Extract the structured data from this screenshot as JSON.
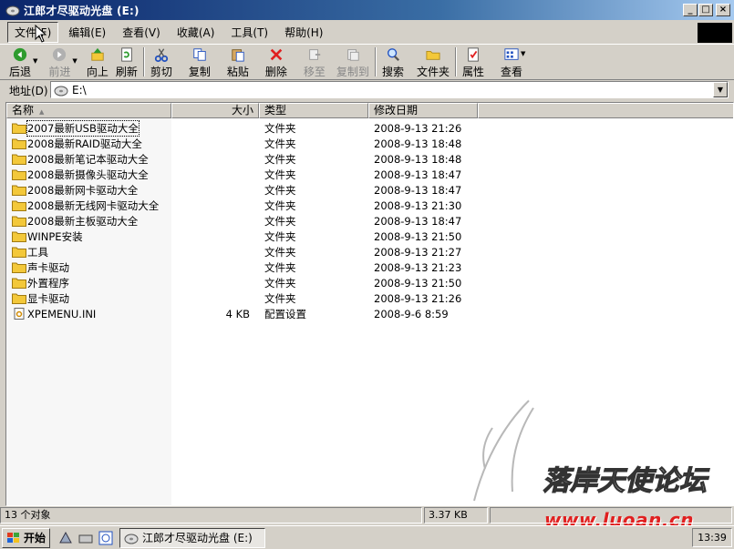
{
  "window": {
    "title": "江郎才尽驱动光盘 (E:)"
  },
  "menu": [
    "文件(F)",
    "编辑(E)",
    "查看(V)",
    "收藏(A)",
    "工具(T)",
    "帮助(H)"
  ],
  "toolbar": {
    "back": "后退",
    "forward": "前进",
    "up": "向上",
    "refresh": "刷新",
    "cut": "剪切",
    "copy": "复制",
    "paste": "粘贴",
    "delete": "删除",
    "move_to": "移至",
    "copy_to": "复制到",
    "search": "搜索",
    "folders": "文件夹",
    "properties": "属性",
    "view": "查看"
  },
  "address": {
    "label": "地址(D)",
    "value": "E:\\"
  },
  "columns": {
    "name": "名称",
    "size": "大小",
    "type": "类型",
    "modified": "修改日期"
  },
  "files": [
    {
      "name": "2007最新USB驱动大全",
      "size": "",
      "type": "文件夹",
      "modified": "2008-9-13 21:26",
      "icon": "folder-icon"
    },
    {
      "name": "2008最新RAID驱动大全",
      "size": "",
      "type": "文件夹",
      "modified": "2008-9-13 18:48",
      "icon": "folder-icon"
    },
    {
      "name": "2008最新笔记本驱动大全",
      "size": "",
      "type": "文件夹",
      "modified": "2008-9-13 18:48",
      "icon": "folder-icon"
    },
    {
      "name": "2008最新摄像头驱动大全",
      "size": "",
      "type": "文件夹",
      "modified": "2008-9-13 18:47",
      "icon": "folder-icon"
    },
    {
      "name": "2008最新网卡驱动大全",
      "size": "",
      "type": "文件夹",
      "modified": "2008-9-13 18:47",
      "icon": "folder-icon"
    },
    {
      "name": "2008最新无线网卡驱动大全",
      "size": "",
      "type": "文件夹",
      "modified": "2008-9-13 21:30",
      "icon": "folder-icon"
    },
    {
      "name": "2008最新主板驱动大全",
      "size": "",
      "type": "文件夹",
      "modified": "2008-9-13 18:47",
      "icon": "folder-icon"
    },
    {
      "name": "WINPE安装",
      "size": "",
      "type": "文件夹",
      "modified": "2008-9-13 21:50",
      "icon": "folder-icon"
    },
    {
      "name": "工具",
      "size": "",
      "type": "文件夹",
      "modified": "2008-9-13 21:27",
      "icon": "folder-icon"
    },
    {
      "name": "声卡驱动",
      "size": "",
      "type": "文件夹",
      "modified": "2008-9-13 21:23",
      "icon": "folder-icon"
    },
    {
      "name": "外置程序",
      "size": "",
      "type": "文件夹",
      "modified": "2008-9-13 21:50",
      "icon": "folder-icon"
    },
    {
      "name": "显卡驱动",
      "size": "",
      "type": "文件夹",
      "modified": "2008-9-13 21:26",
      "icon": "folder-icon"
    },
    {
      "name": "XPEMENU.INI",
      "size": "4 KB",
      "type": "配置设置",
      "modified": "2008-9-6 8:59",
      "icon": "ini-file-icon"
    }
  ],
  "status": {
    "count": "13 个对象",
    "size": "3.37 KB"
  },
  "watermark": {
    "text": "落岸天使论坛",
    "url": "www.luoan.cn"
  },
  "taskbar": {
    "start": "开始",
    "task": "江郎才尽驱动光盘 (E:)",
    "clock": "13:39"
  }
}
